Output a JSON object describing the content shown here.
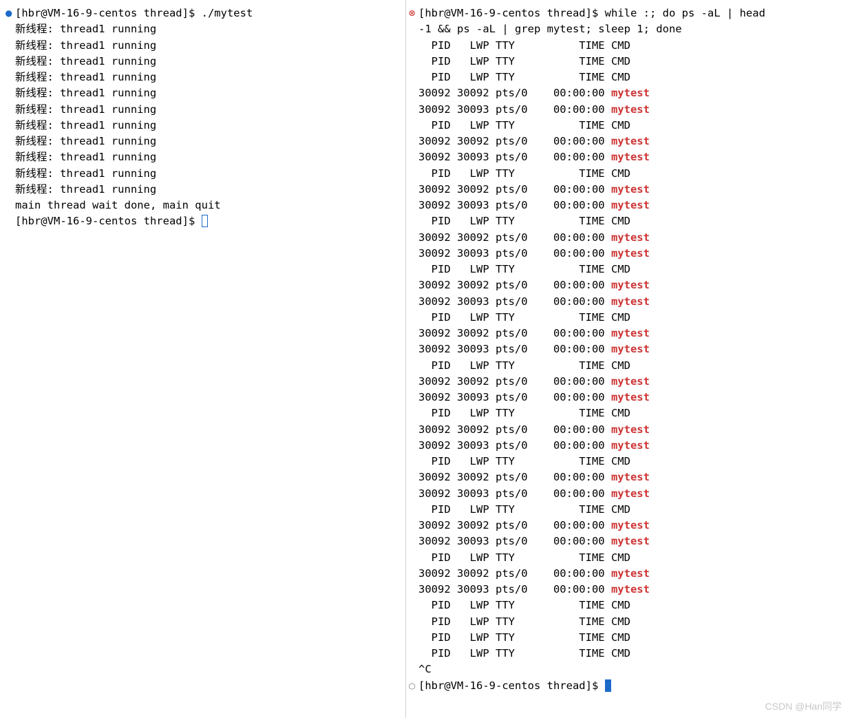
{
  "left": {
    "prompt": "[hbr@VM-16-9-centos thread]$",
    "command": "./mytest",
    "thread_label": "新线程:",
    "thread_text": "thread1 running",
    "thread_repeat": 11,
    "done_line": "main thread wait done, main quit",
    "prompt2": "[hbr@VM-16-9-centos thread]$"
  },
  "right": {
    "prompt": "[hbr@VM-16-9-centos thread]$",
    "command": "while :; do ps -aL | head",
    "command2": "-1 && ps -aL | grep mytest; sleep 1; done",
    "header": "  PID   LWP TTY          TIME CMD",
    "row1": "30092 30092 pts/0    00:00:00 ",
    "row2": "30092 30093 pts/0    00:00:00 ",
    "match": "mytest",
    "initial_headers": 3,
    "cycles": 11,
    "trailing_headers": 4,
    "interrupt": "^C",
    "prompt2": "[hbr@VM-16-9-centos thread]$"
  },
  "watermark": "CSDN @Han同学"
}
